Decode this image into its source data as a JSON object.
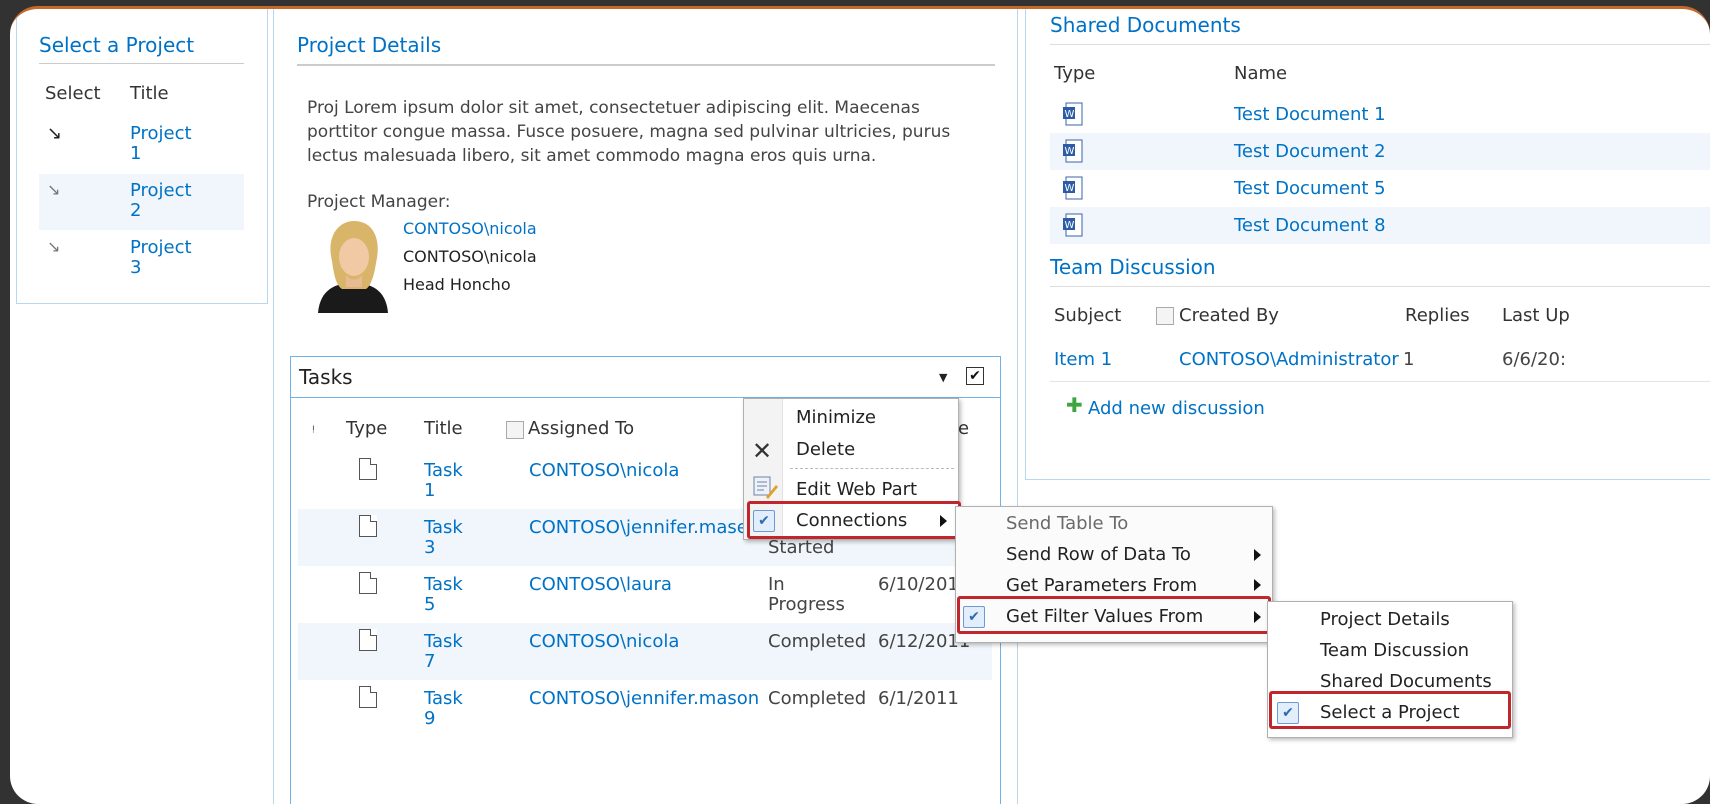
{
  "select_project": {
    "title": "Select a Project",
    "col_select": "Select",
    "col_title": "Title",
    "rows": [
      {
        "line1": "Project",
        "line2": "1"
      },
      {
        "line1": "Project",
        "line2": "2"
      },
      {
        "line1": "Project",
        "line2": "3"
      }
    ]
  },
  "project_details": {
    "title": "Project Details",
    "desc_line1": "Proj Lorem ipsum dolor sit amet, consectetuer adipiscing elit. Maecenas",
    "desc_line2": "porttitor congue massa. Fusce posuere, magna sed pulvinar ultricies, purus",
    "desc_line3": "lectus malesuada libero, sit amet commodo magna eros quis urna.",
    "manager_label": "Project Manager:",
    "manager_link": "CONTOSO\\nicola",
    "manager_account": "CONTOSO\\nicola",
    "manager_title": "Head Honcho"
  },
  "tasks": {
    "title": "Tasks",
    "col_type": "Type",
    "col_title": "Title",
    "col_assigned": "Assigned To",
    "col_partial": "e",
    "rows": [
      {
        "t1": "Task",
        "t2": "1",
        "assigned": "CONTOSO\\nicola",
        "status1": "",
        "status2": "",
        "date": ""
      },
      {
        "t1": "Task",
        "t2": "3",
        "assigned": "CONTOSO\\jennifer.mase",
        "status1": "",
        "status2": "Started",
        "date": ""
      },
      {
        "t1": "Task",
        "t2": "5",
        "assigned": "CONTOSO\\laura",
        "status1": "In",
        "status2": "Progress",
        "date": "6/10/201"
      },
      {
        "t1": "Task",
        "t2": "7",
        "assigned": "CONTOSO\\nicola",
        "status1": "Completed",
        "status2": "",
        "date": "6/12/2011"
      },
      {
        "t1": "Task",
        "t2": "9",
        "assigned": "CONTOSO\\jennifer.mason",
        "status1": "Completed",
        "status2": "",
        "date": "6/1/2011"
      }
    ]
  },
  "web_part_menu": {
    "minimize": "Minimize",
    "delete": "Delete",
    "edit": "Edit Web Part",
    "connections": "Connections"
  },
  "connections_menu": {
    "send_table": "Send Table To",
    "send_row": "Send Row of Data To",
    "get_params": "Get Parameters From",
    "get_filter": "Get Filter Values From"
  },
  "filter_menu": {
    "items": [
      "Project Details",
      "Team Discussion",
      "Shared Documents",
      "Select a Project"
    ]
  },
  "shared_docs": {
    "title": "Shared Documents",
    "col_type": "Type",
    "col_name": "Name",
    "rows": [
      "Test Document 1",
      "Test Document 2",
      "Test Document 5",
      "Test Document 8"
    ]
  },
  "team_discussion": {
    "title": "Team Discussion",
    "col_subject": "Subject",
    "col_created": "Created By",
    "col_replies": "Replies",
    "col_last": "Last Up",
    "row_subject": "Item 1",
    "row_created": "CONTOSO\\Administrator",
    "row_replies": "1",
    "row_last": "6/6/20:",
    "add_new": "Add new discussion"
  },
  "colors": {
    "link": "#0072c6",
    "highlight": "#c0272d",
    "frame_accent": "#c46a28"
  }
}
